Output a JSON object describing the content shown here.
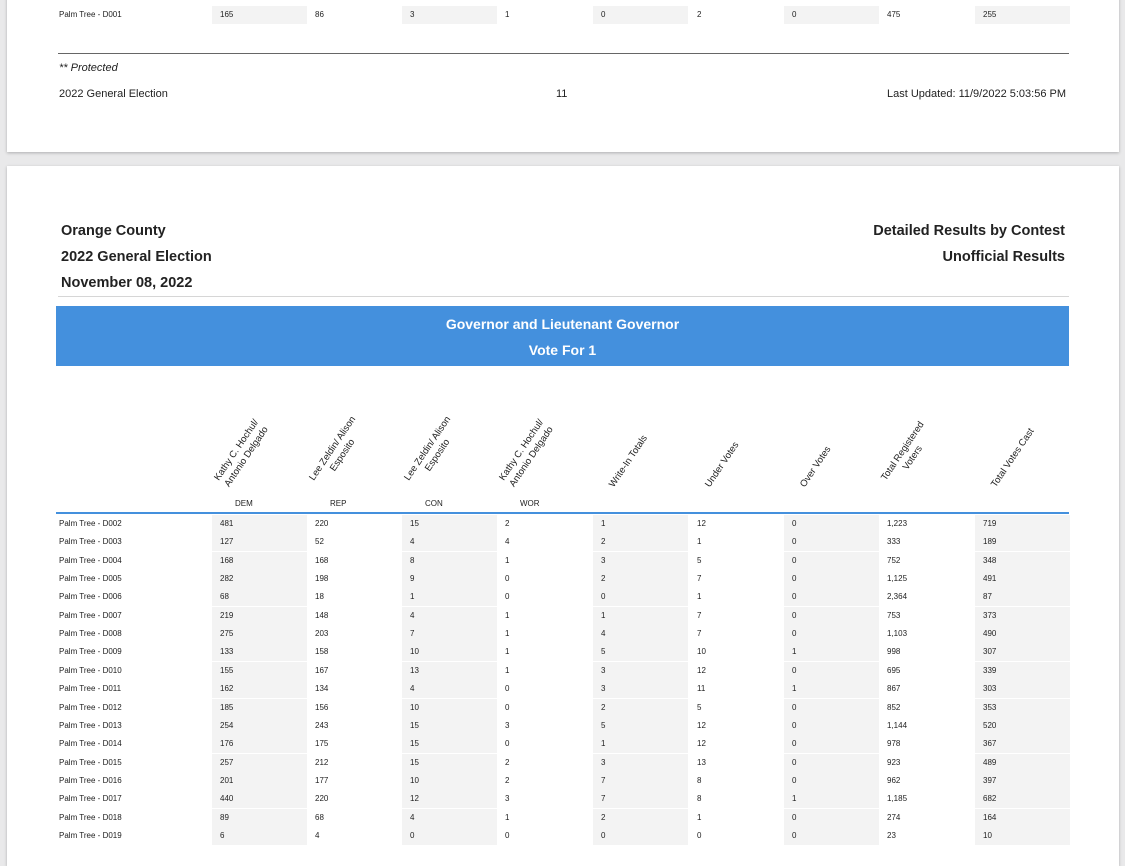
{
  "page1": {
    "last_row": {
      "precinct": "Palm Tree - D001",
      "values": [
        "165",
        "86",
        "3",
        "1",
        "0",
        "2",
        "0",
        "475",
        "255"
      ]
    },
    "footer": {
      "note": "** Protected",
      "election": "2022 General Election",
      "page_number": "11",
      "last_updated": "Last Updated: 11/9/2022 5:03:56 PM"
    }
  },
  "page2": {
    "header": {
      "county": "Orange County",
      "election": "2022 General Election",
      "date": "November 08, 2022",
      "report_type": "Detailed Results by Contest",
      "status": "Unofficial Results"
    },
    "contest": {
      "title": "Governor and Lieutenant Governor",
      "vote_for": "Vote For 1"
    },
    "columns": [
      {
        "line1": "Kathy C. Hochul/",
        "line2": "Antonio Delgado",
        "party": "DEM"
      },
      {
        "line1": "Lee Zeldin/ Alison",
        "line2": "Esposito",
        "party": "REP"
      },
      {
        "line1": "Lee Zeldin/ Alison",
        "line2": "Esposito",
        "party": "CON"
      },
      {
        "line1": "Kathy C. Hochul/",
        "line2": "Antonio Delgado",
        "party": "WOR"
      },
      {
        "line1": "Write-In Totals",
        "line2": "",
        "party": ""
      },
      {
        "line1": "Under Votes",
        "line2": "",
        "party": ""
      },
      {
        "line1": "Over Votes",
        "line2": "",
        "party": ""
      },
      {
        "line1": "Total Registered",
        "line2": "Voters",
        "party": ""
      },
      {
        "line1": "Total Votes Cast",
        "line2": "",
        "party": ""
      }
    ],
    "rows": [
      {
        "precinct": "Palm Tree - D002",
        "values": [
          "481",
          "220",
          "15",
          "2",
          "1",
          "12",
          "0",
          "1,223",
          "719"
        ]
      },
      {
        "precinct": "Palm Tree - D003",
        "values": [
          "127",
          "52",
          "4",
          "4",
          "2",
          "1",
          "0",
          "333",
          "189"
        ]
      },
      {
        "precinct": "Palm Tree - D004",
        "values": [
          "168",
          "168",
          "8",
          "1",
          "3",
          "5",
          "0",
          "752",
          "348"
        ]
      },
      {
        "precinct": "Palm Tree - D005",
        "values": [
          "282",
          "198",
          "9",
          "0",
          "2",
          "7",
          "0",
          "1,125",
          "491"
        ]
      },
      {
        "precinct": "Palm Tree - D006",
        "values": [
          "68",
          "18",
          "1",
          "0",
          "0",
          "1",
          "0",
          "2,364",
          "87"
        ]
      },
      {
        "precinct": "Palm Tree - D007",
        "values": [
          "219",
          "148",
          "4",
          "1",
          "1",
          "7",
          "0",
          "753",
          "373"
        ]
      },
      {
        "precinct": "Palm Tree - D008",
        "values": [
          "275",
          "203",
          "7",
          "1",
          "4",
          "7",
          "0",
          "1,103",
          "490"
        ]
      },
      {
        "precinct": "Palm Tree - D009",
        "values": [
          "133",
          "158",
          "10",
          "1",
          "5",
          "10",
          "1",
          "998",
          "307"
        ]
      },
      {
        "precinct": "Palm Tree - D010",
        "values": [
          "155",
          "167",
          "13",
          "1",
          "3",
          "12",
          "0",
          "695",
          "339"
        ]
      },
      {
        "precinct": "Palm Tree - D011",
        "values": [
          "162",
          "134",
          "4",
          "0",
          "3",
          "11",
          "1",
          "867",
          "303"
        ]
      },
      {
        "precinct": "Palm Tree - D012",
        "values": [
          "185",
          "156",
          "10",
          "0",
          "2",
          "5",
          "0",
          "852",
          "353"
        ]
      },
      {
        "precinct": "Palm Tree - D013",
        "values": [
          "254",
          "243",
          "15",
          "3",
          "5",
          "12",
          "0",
          "1,144",
          "520"
        ]
      },
      {
        "precinct": "Palm Tree - D014",
        "values": [
          "176",
          "175",
          "15",
          "0",
          "1",
          "12",
          "0",
          "978",
          "367"
        ]
      },
      {
        "precinct": "Palm Tree - D015",
        "values": [
          "257",
          "212",
          "15",
          "2",
          "3",
          "13",
          "0",
          "923",
          "489"
        ]
      },
      {
        "precinct": "Palm Tree - D016",
        "values": [
          "201",
          "177",
          "10",
          "2",
          "7",
          "8",
          "0",
          "962",
          "397"
        ]
      },
      {
        "precinct": "Palm Tree - D017",
        "values": [
          "440",
          "220",
          "12",
          "3",
          "7",
          "8",
          "1",
          "1,185",
          "682"
        ]
      },
      {
        "precinct": "Palm Tree - D018",
        "values": [
          "89",
          "68",
          "4",
          "1",
          "2",
          "1",
          "0",
          "274",
          "164"
        ]
      },
      {
        "precinct": "Palm Tree - D019",
        "values": [
          "6",
          "4",
          "0",
          "0",
          "0",
          "0",
          "0",
          "23",
          "10"
        ]
      }
    ]
  }
}
